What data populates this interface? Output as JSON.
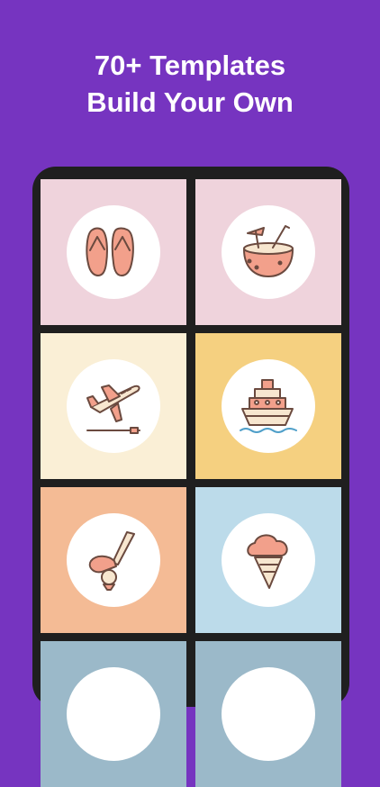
{
  "headline": {
    "line1": "70+ Templates",
    "line2": "Build Your Own"
  },
  "tiles": [
    {
      "icon": "flip-flops-icon",
      "bg": "#efd3dc"
    },
    {
      "icon": "coconut-drink-icon",
      "bg": "#efd3dc"
    },
    {
      "icon": "airplane-takeoff-icon",
      "bg": "#faefd6"
    },
    {
      "icon": "cruise-ship-icon",
      "bg": "#f5d080"
    },
    {
      "icon": "golf-club-icon",
      "bg": "#f4bb95"
    },
    {
      "icon": "ice-cream-cone-icon",
      "bg": "#bcdbea"
    },
    {
      "icon": "partial-tile-icon",
      "bg": "#9bb9c9"
    },
    {
      "icon": "partial-tile-icon",
      "bg": "#9bb9c9"
    }
  ],
  "colors": {
    "background": "#7634c0",
    "phone_frame": "#1f1f1f",
    "icon_outline": "#6b4a3f",
    "icon_fill_salmon": "#f2a08b",
    "icon_fill_cream": "#f7e6cf"
  }
}
